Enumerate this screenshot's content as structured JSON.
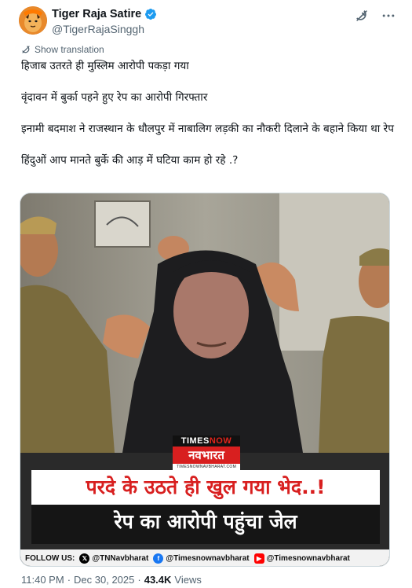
{
  "author": {
    "name": "Tiger Raja Satire",
    "handle": "@TigerRajaSinggh",
    "verified_color": "#1d9bf0"
  },
  "actions": {
    "grok_icon": "grok-icon",
    "more_icon": "more-icon"
  },
  "translation": {
    "label": "Show translation"
  },
  "tweet": {
    "paragraphs": [
      "हिजाब उतरते ही मुस्लिम आरोपी पकड़ा गया",
      "वृंदावन में बुर्का पहने हुए रेप का आरोपी गिरफ्तार",
      "इनामी बदमाश ने राजस्थान के धौलपुर में नाबालिग लड़की का नौकरी दिलाने के बहाने किया था रेप",
      "हिंदुओं आप मानते बुर्के की आड़ में घटिया काम हो रहे .?"
    ]
  },
  "media": {
    "logo_top_prefix": "TIMES",
    "logo_top_suffix": "NOW",
    "logo_main": "नवभारत",
    "logo_url": "TIMESNOWNAVBHARAT.COM",
    "headline_1": "परदे के उठते ही खुल गया भेद..!",
    "headline_2": "रेप का आरोपी पहुंचा जेल",
    "follow_label": "FOLLOW US:",
    "follow_x": "@TNNavbharat",
    "follow_fb": "@Timesnownavbharat",
    "follow_yt": "@Timesnownavbharat",
    "brand_red": "#d81f1f"
  },
  "meta": {
    "time": "11:40 PM",
    "separator": "·",
    "date": "Dec 30, 2025",
    "views_count": "43.4K",
    "views_label": "Views"
  }
}
